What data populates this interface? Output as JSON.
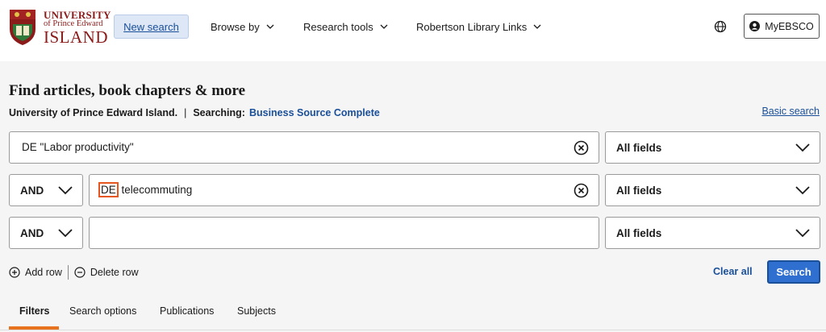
{
  "header": {
    "logo": {
      "line1": "UNIVERSITY",
      "line2": "of Prince Edward",
      "line3": "ISLAND"
    },
    "new_search": "New search",
    "nav": [
      {
        "label": "Browse by"
      },
      {
        "label": "Research tools"
      },
      {
        "label": "Robertson Library Links"
      }
    ],
    "language_icon": "globe-icon",
    "myebsco": "MyEBSCO"
  },
  "page": {
    "title": "Find articles, book chapters & more",
    "institution": "University of Prince Edward Island.",
    "searching_label": "Searching:",
    "database": "Business Source Complete",
    "basic_search": "Basic search"
  },
  "search_rows": [
    {
      "operator": "",
      "value": "DE \"Labor productivity\"",
      "field": "All fields"
    },
    {
      "operator": "AND",
      "value_highlight": "DE",
      "value_rest": " telecommuting",
      "field": "All fields"
    },
    {
      "operator": "AND",
      "value": "",
      "field": "All fields"
    }
  ],
  "actions": {
    "add_row": "Add row",
    "delete_row": "Delete row",
    "clear_all": "Clear all",
    "search": "Search"
  },
  "tabs": [
    {
      "label": "Filters",
      "active": true
    },
    {
      "label": "Search options",
      "active": false
    },
    {
      "label": "Publications",
      "active": false
    },
    {
      "label": "Subjects",
      "active": false
    }
  ],
  "colors": {
    "accent": "#1a4f99",
    "brand": "#8b1a1a",
    "highlight": "#e8561f",
    "tab_active": "#e8731f"
  }
}
